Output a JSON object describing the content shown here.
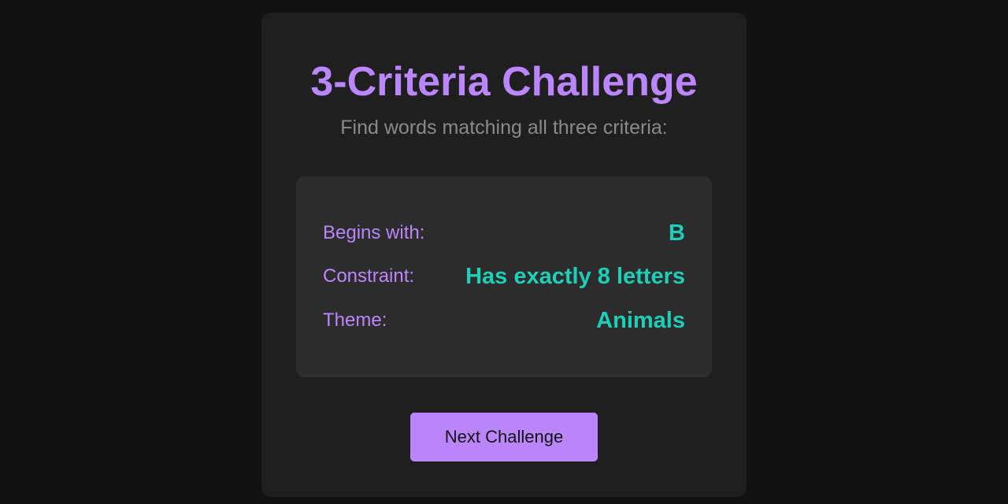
{
  "challenge": {
    "title": "3-Criteria Challenge",
    "subtitle": "Find words matching all three criteria:",
    "criteria": [
      {
        "label": "Begins with:",
        "value": "B"
      },
      {
        "label": "Constraint:",
        "value": "Has exactly 8 letters"
      },
      {
        "label": "Theme:",
        "value": "Animals"
      }
    ],
    "next_label": "Next Challenge"
  },
  "colors": {
    "page_background": "#121212",
    "card_background": "#1f1f1f",
    "criteria_background": "#2c2c2c",
    "accent_purple": "#bb86fc",
    "accent_teal": "#1ccfb8",
    "muted_text": "#8a8a8a"
  }
}
